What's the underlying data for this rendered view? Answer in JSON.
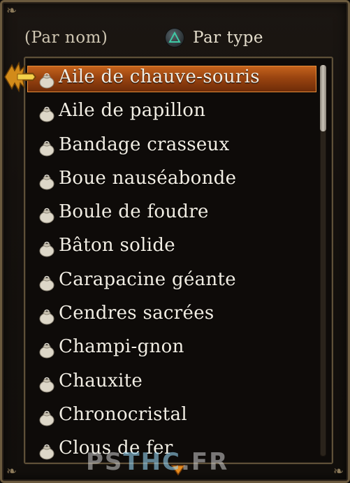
{
  "sort": {
    "by_name_label": "(Par nom)",
    "by_type_label": "Par type",
    "button_icon": "triangle-button-icon"
  },
  "items": [
    {
      "label": "Aile de chauve-souris",
      "icon": "bag-icon",
      "selected": true
    },
    {
      "label": "Aile de papillon",
      "icon": "bag-icon",
      "selected": false
    },
    {
      "label": "Bandage crasseux",
      "icon": "bag-icon",
      "selected": false
    },
    {
      "label": "Boue nauséabonde",
      "icon": "bag-icon",
      "selected": false
    },
    {
      "label": "Boule de foudre",
      "icon": "bag-icon",
      "selected": false
    },
    {
      "label": "Bâton solide",
      "icon": "bag-icon",
      "selected": false
    },
    {
      "label": "Carapacine géante",
      "icon": "bag-icon",
      "selected": false
    },
    {
      "label": "Cendres sacrées",
      "icon": "bag-icon",
      "selected": false
    },
    {
      "label": "Champi-gnon",
      "icon": "bag-icon",
      "selected": false
    },
    {
      "label": "Chauxite",
      "icon": "bag-icon",
      "selected": false
    },
    {
      "label": "Chronocristal",
      "icon": "bag-icon",
      "selected": false
    },
    {
      "label": "Clous de fer",
      "icon": "bag-icon",
      "selected": false
    }
  ],
  "watermark": {
    "part1": "PS",
    "part2": "THC",
    "part3": ".FR"
  },
  "colors": {
    "highlight": "#c4631c",
    "border": "#6b5a3e",
    "text": "#f2eee4"
  }
}
